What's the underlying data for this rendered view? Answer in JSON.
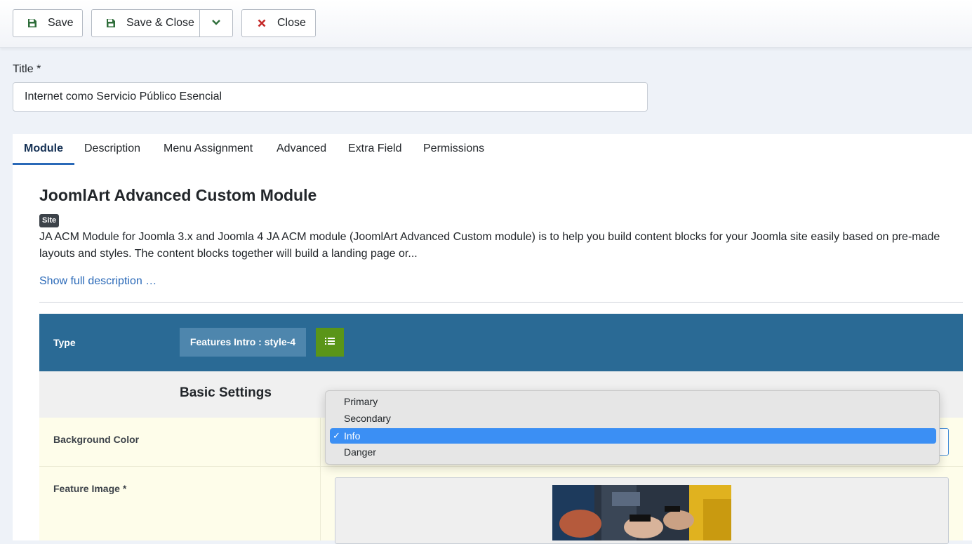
{
  "toolbar": {
    "save_label": "Save",
    "save_close_label": "Save & Close",
    "close_label": "Close"
  },
  "title_field": {
    "label": "Title *",
    "value": "Internet como Servicio Público Esencial"
  },
  "tabs": [
    {
      "label": "Module",
      "active": true
    },
    {
      "label": "Description",
      "active": false
    },
    {
      "label": "Menu Assignment",
      "active": false
    },
    {
      "label": "Advanced",
      "active": false
    },
    {
      "label": "Extra Field",
      "active": false
    },
    {
      "label": "Permissions",
      "active": false
    }
  ],
  "module": {
    "title": "JoomlArt Advanced Custom Module",
    "badge": "Site",
    "description": "JA ACM Module for Joomla 3.x and Joomla 4 JA ACM module (JoomlArt Advanced Custom module) is to help you build content blocks for your Joomla site easily based on pre-made layouts and styles. The content blocks together will build a landing page or...",
    "show_full": "Show full description …"
  },
  "type_bar": {
    "label": "Type",
    "value": "Features Intro : style-4"
  },
  "settings": {
    "section_title": "Basic Settings",
    "background_color_label": "Background Color",
    "feature_image_label": "Feature Image *"
  },
  "dropdown": {
    "options": [
      "Primary",
      "Secondary",
      "Info",
      "Danger"
    ],
    "selected": "Info"
  },
  "colors": {
    "type_bar": "#2a6a95",
    "type_value_bg": "#4e86ad",
    "list_button": "#5a9518",
    "selected_option": "#3b8ff4",
    "row_highlight": "#fefdea",
    "link": "#2a69b8"
  }
}
